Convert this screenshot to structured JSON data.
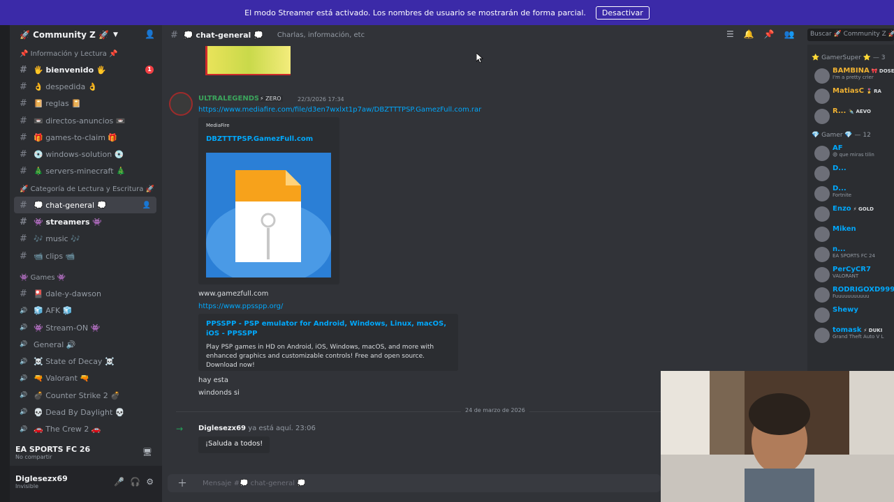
{
  "banner": {
    "text": "El modo Streamer está activado. Los nombres de usuario se mostrarán de forma parcial.",
    "button": "Desactivar"
  },
  "server": {
    "name": "🚀 Community Z 🚀"
  },
  "categories": {
    "info": "📌 Información y Lectura 📌",
    "escritura": "🚀 Categoría de Lectura y Escritura 🚀",
    "games": "👾 Games 👾"
  },
  "channels_info": [
    {
      "label": "🖐️ bienvenido 🖐️",
      "badge": "1"
    },
    {
      "label": "👌 despedida 👌"
    },
    {
      "label": "📔 reglas 📔"
    },
    {
      "label": "📼 directos-anuncios 📼"
    },
    {
      "label": "🎁 games-to-claim 🎁"
    },
    {
      "label": "💿 windows-solution 💿"
    },
    {
      "label": "🎄 servers-minecraft 🎄"
    }
  ],
  "channels_text": [
    {
      "label": "💭 chat-general 💭"
    },
    {
      "label": "👾 streamers 👾"
    },
    {
      "label": "🎶 music 🎶"
    },
    {
      "label": "📹 clips 📹"
    }
  ],
  "channels_games": [
    {
      "label": "🎴 dale-y-dawson"
    },
    {
      "label": "🧊 AFK 🧊"
    },
    {
      "label": "👾 Stream-ON 👾"
    },
    {
      "label": "General 🔊"
    },
    {
      "label": "☠️ State of Decay ☠️"
    },
    {
      "label": "🔫 Valorant 🔫"
    },
    {
      "label": "💣 Counter Strike 2 💣"
    },
    {
      "label": "💀 Dead By Daylight 💀"
    },
    {
      "label": "🚗 The Crew 2 🚗"
    }
  ],
  "activity": {
    "title": "EA SPORTS FC 26",
    "sub": "No compartir"
  },
  "user": {
    "name": "Diglesezx69",
    "status": "Invisible"
  },
  "topbar": {
    "channel": "💭 chat-general 💭",
    "topic": "Charlas, información, etc",
    "search": "Buscar 🚀 Community Z 🚀"
  },
  "message": {
    "author": "ULTRALEGENDS25",
    "tag": "⚡ ZERO",
    "time": "22/3/2026 17:34",
    "link1": "https://www.mediafire.com/file/d3en7wxlxt1p7aw/DBZTTTPSP.GamezFull.com.rar",
    "embed_provider": "MediaFire",
    "embed_title": "DBZTTTPSP.GamezFull.com",
    "line1": "www.gamezfull.com",
    "link2": "https://www.ppsspp.org/",
    "embed2_title": "PPSSPP - PSP emulator for Android, Windows, Linux, macOS, iOS - PPSSPP",
    "embed2_desc": "Play PSP games in HD on Android, iOS, Windows, macOS, and more with enhanced graphics and customizable controls! Free and open source. Download now!",
    "line2": "hay esta",
    "line3": "windonds si"
  },
  "divider_date": "24 de marzo de 2026",
  "join": {
    "name": "Diglesezx69",
    "text": " ya está aquí.",
    "time": "23:06",
    "wave": "¡Saluda a todos!"
  },
  "composer": {
    "placeholder": "Mensaje #💭 chat-general 💭"
  },
  "members": {
    "group1": "⭐ GamerSuper ⭐ — 3",
    "group1_list": [
      {
        "name": "BAMBINA",
        "tag": "🎀 DOSE",
        "status": "I'm a pretty crier",
        "color": "#f0b232"
      },
      {
        "name": "MatiasC",
        "tag": "🎖️ RA",
        "status": "",
        "color": "#f0b232"
      },
      {
        "name": "R...",
        "tag": "✒️ AEVO",
        "status": "",
        "color": "#f0b232"
      }
    ],
    "group2": "💎 Gamer 💎 — 12",
    "group2_list": [
      {
        "name": "AF",
        "status": "😄 que miras tilin",
        "color": "#00a8fc"
      },
      {
        "name": "D...",
        "status": "",
        "color": "#00a8fc"
      },
      {
        "name": "D...",
        "status": "Fortnite",
        "color": "#00a8fc"
      },
      {
        "name": "Enzo",
        "tag": "⚡ GOLD",
        "status": "",
        "color": "#00a8fc"
      },
      {
        "name": "Miken",
        "status": "",
        "color": "#00a8fc"
      },
      {
        "name": "n...",
        "status": "EA SPORTS FC 24",
        "color": "#00a8fc"
      },
      {
        "name": "PerCyCR7",
        "status": "VALORANT",
        "color": "#00a8fc"
      },
      {
        "name": "RODRIGOXD999",
        "status": "Fuuuuuuuuuuu",
        "color": "#00a8fc"
      },
      {
        "name": "Shewy",
        "status": "",
        "color": "#00a8fc"
      },
      {
        "name": "tomask",
        "tag": "⚡ DUKI",
        "status": "Grand Theft Auto V L",
        "color": "#00a8fc"
      }
    ]
  }
}
